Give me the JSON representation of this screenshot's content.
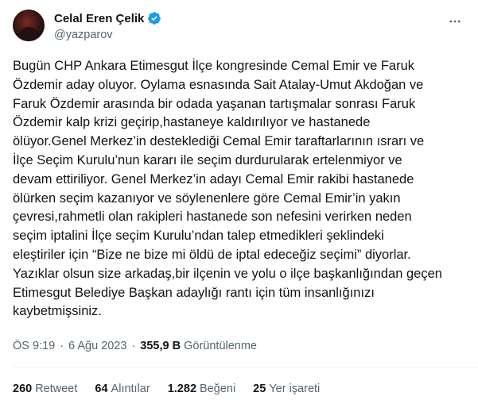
{
  "author": {
    "name": "Celal Eren Çelik",
    "handle": "@yazparov",
    "verified_color": "#1d9bf0"
  },
  "tweet": {
    "lines": [
      "Bugün CHP Ankara Etimesgut İlçe kongresinde Cemal Emir ve Faruk",
      "Özdemir aday oluyor. Oylama esnasında Sait Atalay-Umut Akdoğan ve",
      "Faruk Özdemir arasında bir odada yaşanan tartışmalar sonrası Faruk",
      "Özdemir kalp krizi geçirip,hastaneye kaldırılıyor ve hastanede",
      "ölüyor.Genel Merkez’in desteklediği Cemal Emir taraftarlarının ısrarı ve",
      "İlçe Seçim Kurulu’nun kararı ile seçim durdurularak ertelenmiyor ve",
      "devam ettiriliyor. Genel Merkez’in adayı Cemal Emir rakibi hastanede",
      "ölürken seçim kazanıyor ve söylenenlere göre Cemal Emir’in yakın",
      "çevresi,rahmetli olan rakipleri hastanede son nefesini verirken neden",
      "seçim iptalini İlçe seçim Kurulu’ndan talep etmedikleri şeklindeki",
      "eleştiriler için “Bize ne bize mi öldü de iptal edeceğiz seçimi” diyorlar.",
      "Yazıklar olsun size arkadaş,bir ilçenin ve yolu o ilçe başkanlığından geçen",
      "Etimesgut Belediye Başkan adaylığı rantı için tüm insanlığınızı",
      "kaybetmişsiniz."
    ]
  },
  "meta": {
    "time": "ÖS 9:19",
    "sep1": "·",
    "date": "6 Ağu 2023",
    "sep2": "·",
    "views": "355,9 B",
    "views_label": "Görüntülenme"
  },
  "stats": {
    "retweets_count": "260",
    "retweets_label": "Retweet",
    "quotes_count": "64",
    "quotes_label": "Alıntılar",
    "likes_count": "1.282",
    "likes_label": "Beğeni",
    "bookmarks_count": "25",
    "bookmarks_label": "Yer işareti"
  }
}
